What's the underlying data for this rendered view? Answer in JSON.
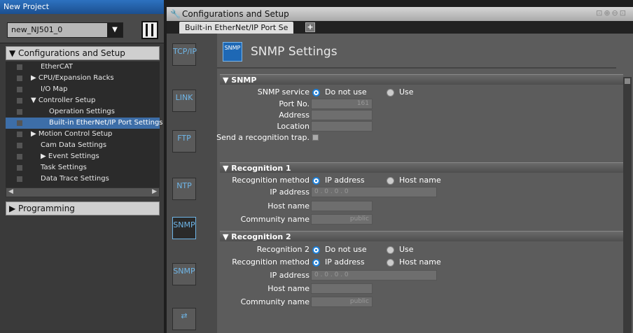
{
  "project_panel": {
    "title": "New Project",
    "device_name": "new_NJ501_0",
    "dropdown_glyph": "▼",
    "config_section": "▼ Configurations and Setup",
    "programming_section": "▶ Programming",
    "tree": [
      {
        "label": "EtherCAT",
        "icon": "ethercat-icon"
      },
      {
        "label": "▶ CPU/Expansion Racks",
        "icon": "rack-icon"
      },
      {
        "label": "I/O Map",
        "icon": "io-map-icon"
      },
      {
        "label": "▼ Controller Setup",
        "icon": "controller-icon"
      },
      {
        "label": "Operation Settings",
        "icon": "settings-icon"
      },
      {
        "label": "Built-in EtherNet/IP Port Settings",
        "icon": "ethernet-icon"
      },
      {
        "label": "▶ Motion Control Setup",
        "icon": "motion-icon"
      },
      {
        "label": "Cam Data Settings",
        "icon": "cam-icon"
      },
      {
        "label": "▶ Event Settings",
        "icon": "event-icon"
      },
      {
        "label": "Task Settings",
        "icon": "task-icon"
      },
      {
        "label": "Data Trace Settings",
        "icon": "trace-icon"
      }
    ]
  },
  "editor": {
    "window_title": "Configurations and Setup",
    "tab_label": "Built-in EtherNet/IP Port Se",
    "tab_add": "+",
    "side_icons": [
      {
        "label": "TCP/IP"
      },
      {
        "label": "LINK"
      },
      {
        "label": "FTP"
      },
      {
        "label": "NTP"
      },
      {
        "label": "SNMP"
      },
      {
        "label": "SNMP"
      }
    ],
    "page_title": "SNMP Settings",
    "badge": "SNMP"
  },
  "snmp": {
    "header": "▼ SNMP",
    "service_label": "SNMP service",
    "service_options": [
      "Do not use",
      "Use"
    ],
    "service_selected": "Do not use",
    "port_label": "Port No.",
    "port_value": "161",
    "address_label": "Address",
    "address_value": "",
    "location_label": "Location",
    "location_value": "",
    "trap_label": "Send a recognition trap."
  },
  "recognition1": {
    "header": "▼ Recognition 1",
    "method_label": "Recognition method",
    "method_options": [
      "IP address",
      "Host name"
    ],
    "method_selected": "IP address",
    "ip_label": "IP address",
    "ip_value": "0 . 0 . 0 . 0",
    "host_label": "Host name",
    "host_value": "",
    "community_label": "Community name",
    "community_value": "public"
  },
  "recognition2": {
    "header": "▼ Recognition 2",
    "use_label": "Recognition 2",
    "use_options": [
      "Do not use",
      "Use"
    ],
    "use_selected": "Do not use",
    "method_label": "Recognition method",
    "method_options": [
      "IP address",
      "Host name"
    ],
    "method_selected": "IP address",
    "ip_label": "IP address",
    "ip_value": "0 . 0 . 0 . 0",
    "host_label": "Host name",
    "host_value": "",
    "community_label": "Community name",
    "community_value": "public"
  }
}
